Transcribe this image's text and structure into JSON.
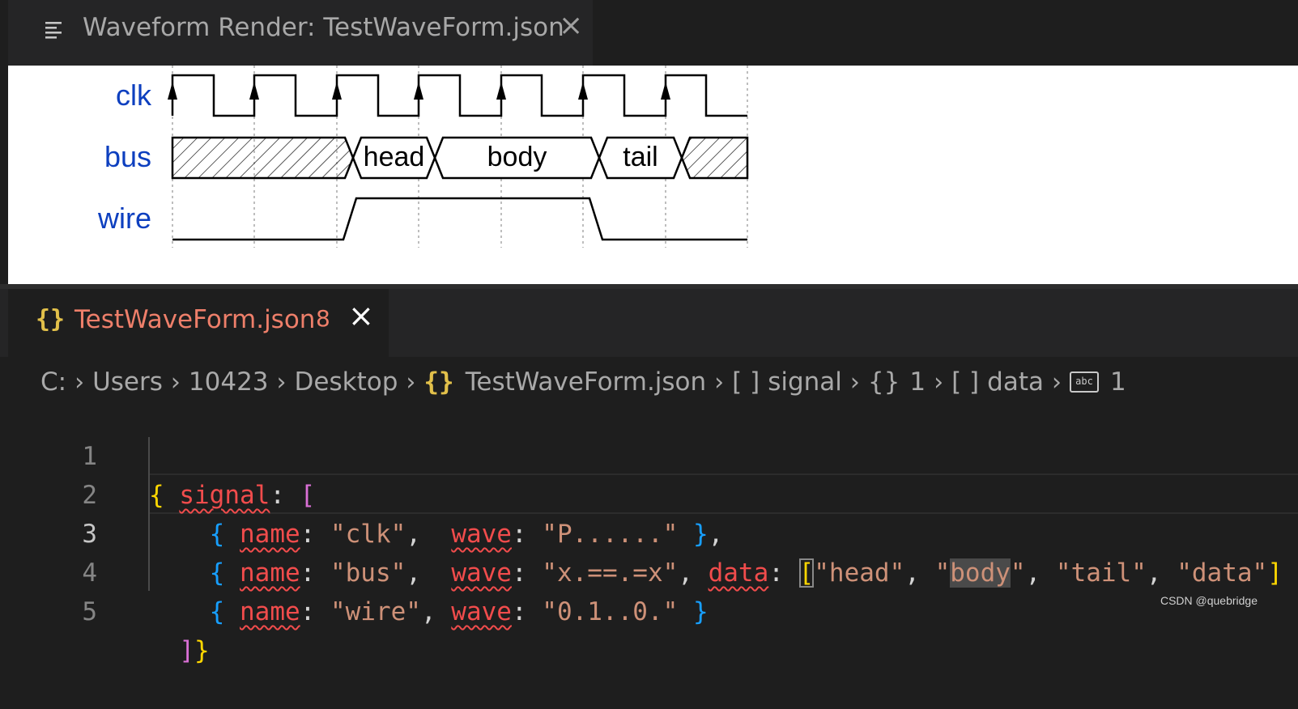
{
  "waveform_tab": {
    "title": "Waveform Render: TestWaveForm.json",
    "close_icon": "×"
  },
  "waveform": {
    "signals": [
      {
        "name": "clk",
        "wave": "P......"
      },
      {
        "name": "bus",
        "wave": "x.==.=x",
        "data": [
          "head",
          "body",
          "tail"
        ]
      },
      {
        "name": "wire",
        "wave": "0.1..0."
      }
    ]
  },
  "file_tab": {
    "icon": "{}",
    "title": "TestWaveForm.json",
    "problems": "8",
    "close_icon": "×"
  },
  "breadcrumb": {
    "drive": "C:",
    "users": "Users",
    "user": "10423",
    "desktop": "Desktop",
    "file_icon": "{}",
    "file": "TestWaveForm.json",
    "signal_icon": "[ ]",
    "signal": "signal",
    "obj_icon": "{}",
    "obj": "1",
    "data_icon": "[ ]",
    "data": "data",
    "str_icon": "abc",
    "str": "1"
  },
  "editor": {
    "line_numbers": [
      "1",
      "2",
      "3",
      "4",
      "5"
    ],
    "active_line": 3
  },
  "watermark": "CSDN @quebridge"
}
